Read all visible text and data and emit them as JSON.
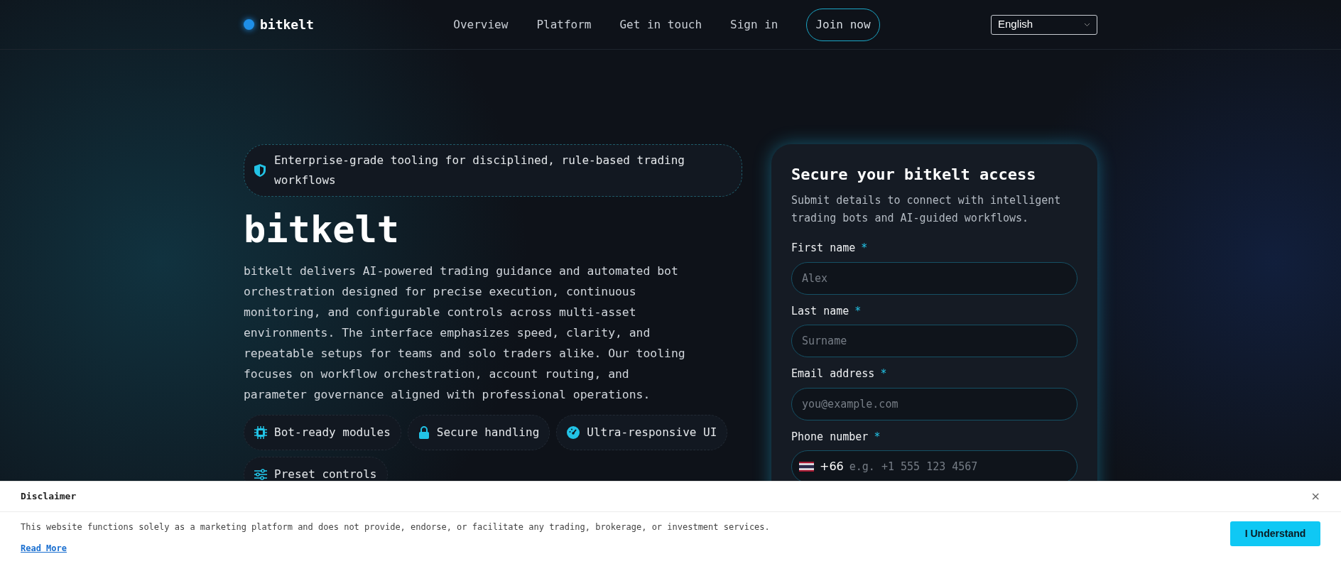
{
  "header": {
    "brand": "bitkelt",
    "nav": [
      {
        "label": "Overview",
        "kind": "link"
      },
      {
        "label": "Platform",
        "kind": "link"
      },
      {
        "label": "Get in touch",
        "kind": "link"
      },
      {
        "label": "Sign in",
        "kind": "link"
      },
      {
        "label": "Join now",
        "kind": "button"
      }
    ],
    "language": "English"
  },
  "hero": {
    "badge": "Enterprise-grade tooling for disciplined, rule-based trading workflows",
    "title": "bitkelt",
    "description": "bitkelt delivers AI-powered trading guidance and automated bot orchestration designed for precise execution, continuous monitoring, and configurable controls across multi-asset environments. The interface emphasizes speed, clarity, and repeatable setups for teams and solo traders alike. Our tooling focuses on workflow orchestration, account routing, and parameter governance aligned with professional operations.",
    "features": [
      {
        "label": "Bot-ready modules",
        "kind": "chip"
      },
      {
        "label": "Secure handling",
        "kind": "lock"
      },
      {
        "label": "Ultra-responsive UI",
        "kind": "gauge"
      },
      {
        "label": "Preset controls",
        "kind": "sliders"
      }
    ]
  },
  "form": {
    "title": "Secure your bitkelt access",
    "subtitle": "Submit details to connect with intelligent trading bots and AI-guided workflows.",
    "fields": [
      {
        "label": "First name",
        "required": "*",
        "placeholder": "Alex",
        "kind": "text"
      },
      {
        "label": "Last name",
        "required": "*",
        "placeholder": "Surname",
        "kind": "text"
      },
      {
        "label": "Email address",
        "required": "*",
        "placeholder": "you@example.com",
        "kind": "text"
      },
      {
        "label": "Phone number",
        "required": "*",
        "placeholder": "e.g. +1 555 123 4567",
        "kind": "phone",
        "dial_code": "+66"
      }
    ]
  },
  "disclaimer": {
    "title": "Disclaimer",
    "close": "×",
    "text": "This website functions solely as a marketing platform and does not provide, endorse, or facilitate any trading, brokerage, or investment services.",
    "link": "Read More",
    "button": "I Understand"
  }
}
